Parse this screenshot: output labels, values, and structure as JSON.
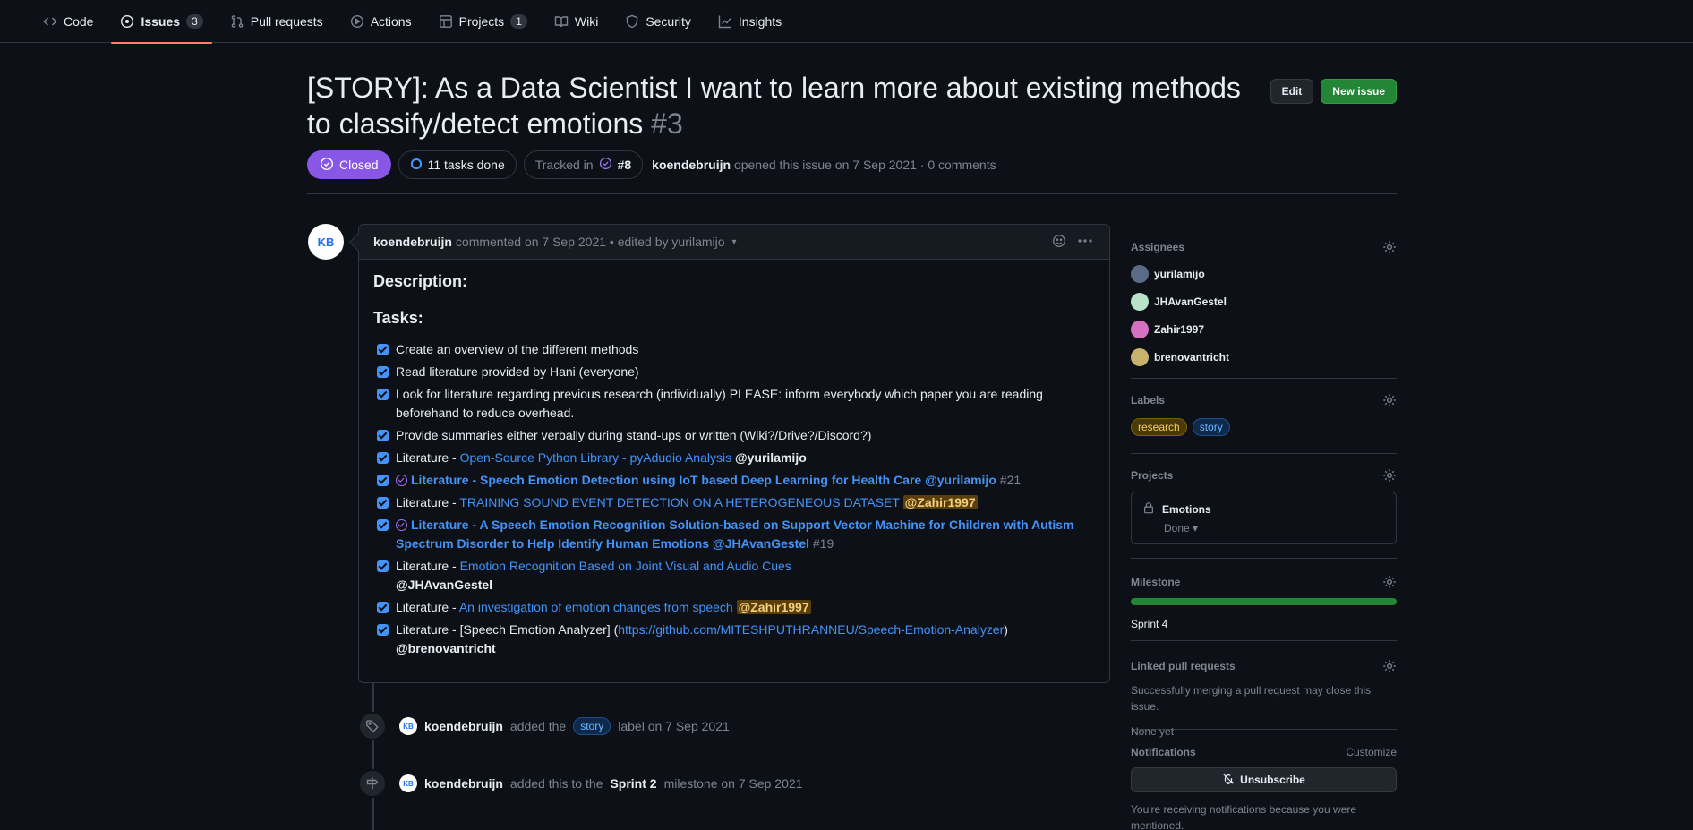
{
  "nav": {
    "items": [
      {
        "label": "Code"
      },
      {
        "label": "Issues",
        "count": "3"
      },
      {
        "label": "Pull requests"
      },
      {
        "label": "Actions"
      },
      {
        "label": "Projects",
        "count": "1"
      },
      {
        "label": "Wiki"
      },
      {
        "label": "Security"
      },
      {
        "label": "Insights"
      }
    ],
    "active": "Issues"
  },
  "issue": {
    "title": "[STORY]: As a Data Scientist I want to learn more about existing methods to classify/detect emotions",
    "number": "#3",
    "edit_label": "Edit",
    "new_issue_label": "New issue",
    "state": "Closed",
    "tasks_done": "11 tasks done",
    "tracked_in_label": "Tracked in",
    "tracked_in_ref": "#8",
    "author": "koendebruijn",
    "opened_text": "opened this issue on 7 Sep 2021 · 0 comments"
  },
  "comment": {
    "author": "koendebruijn",
    "meta": "commented on 7 Sep 2021 • edited by yurilamijo",
    "avatar_text": "KB",
    "description_heading": "Description:",
    "tasks_heading": "Tasks:",
    "tasks": {
      "t1": "Create an overview of the different methods",
      "t2": "Read literature provided by Hani (everyone)",
      "t3": "Look for literature regarding previous research (individually) PLEASE: inform everybody which paper you are reading beforehand to reduce overhead.",
      "t4": "Provide summaries either verbally during stand-ups or written (Wiki?/Drive?/Discord?)",
      "t5_prefix": "Literature - ",
      "t5_link": "Open-Source Python Library - pyAdudio Analysis",
      "t5_mention": "@yurilamijo",
      "t6_link": "Literature - Speech Emotion Detection using IoT based Deep Learning for Health Care @yurilamijo",
      "t6_ref": "#21",
      "t7_prefix": "Literature - ",
      "t7_link": "TRAINING SOUND EVENT DETECTION ON A HETEROGENEOUS DATASET",
      "t7_mention": "@Zahir1997",
      "t8_link": "Literature - A Speech Emotion Recognition Solution-based on Support Vector Machine for Children with Autism Spectrum Disorder to Help Identify Human Emotions @JHAvanGestel",
      "t8_ref": "#19",
      "t9_prefix": "Literature - ",
      "t9_link": "Emotion Recognition Based on Joint Visual and Audio Cues",
      "t9_mention": "@JHAvanGestel",
      "t10_prefix": "Literature - ",
      "t10_link": "An investigation of emotion changes from speech",
      "t10_mention": "@Zahir1997",
      "t11_prefix": "Literature - [Speech Emotion Analyzer] (",
      "t11_link": "https://github.com/MITESHPUTHRANNEU/Speech-Emotion-Analyzer",
      "t11_suffix": ")",
      "t11_mention": "@brenovantricht"
    }
  },
  "timeline": {
    "e1": {
      "author": "koendebruijn",
      "before": "added the",
      "label": "story",
      "after": "label on 7 Sep 2021"
    },
    "e2": {
      "author": "koendebruijn",
      "before": "added this to the",
      "milestone": "Sprint 2",
      "after": "milestone on 7 Sep 2021"
    }
  },
  "sidebar": {
    "assignees_title": "Assignees",
    "assignees": [
      "yurilamijo",
      "JHAvanGestel",
      "Zahir1997",
      "brenovantricht"
    ],
    "labels_title": "Labels",
    "labels": [
      "research",
      "story"
    ],
    "projects_title": "Projects",
    "project_name": "Emotions",
    "project_status": "Done",
    "milestone_title": "Milestone",
    "milestone_progress_percent": 100,
    "milestone_name": "Sprint 4",
    "linked_title": "Linked pull requests",
    "linked_desc": "Successfully merging a pull request may close this issue.",
    "linked_none": "None yet",
    "notifications_title": "Notifications",
    "customize_label": "Customize",
    "unsubscribe_label": "Unsubscribe",
    "notify_reason": "You're receiving notifications because you were mentioned."
  },
  "colors": {
    "accent_link": "#4493f8",
    "closed_purple": "#8957e5",
    "primary_green": "#238636",
    "nav_underline": "#f78166"
  }
}
